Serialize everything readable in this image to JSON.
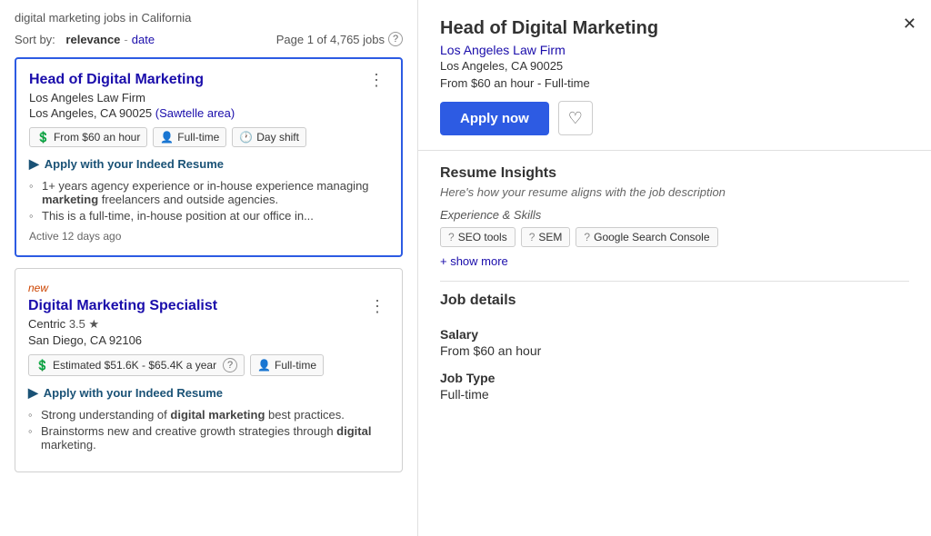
{
  "search": {
    "title": "digital marketing jobs in California",
    "sort_label": "Sort by:",
    "relevance": "relevance",
    "separator": "-",
    "date_label": "date",
    "page_info": "Page 1 of 4,765 jobs"
  },
  "jobs": [
    {
      "id": "job-1",
      "selected": true,
      "title": "Head of Digital Marketing",
      "company": "Los Angeles Law Firm",
      "location": "Los Angeles, CA 90025",
      "location_area": "(Sawtelle area)",
      "badges": [
        {
          "icon": "💲",
          "text": "From $60 an hour"
        },
        {
          "icon": "👤",
          "text": "Full-time"
        },
        {
          "icon": "🕐",
          "text": "Day shift"
        }
      ],
      "apply_indeed": "Apply with your Indeed Resume",
      "bullets": [
        "1+ years agency experience or in-house experience managing <strong>marketing</strong> freelancers and outside agencies.",
        "This is a full-time, in-house position at our office in..."
      ],
      "active": "Active 12 days ago",
      "new": false
    },
    {
      "id": "job-2",
      "selected": false,
      "title": "Digital Marketing Specialist",
      "company": "Centric",
      "rating": "3.5",
      "location": "San Diego, CA 92106",
      "badges": [
        {
          "icon": "💲",
          "text": "Estimated $51.6K - $65.4K a year",
          "has_help": true
        },
        {
          "icon": "👤",
          "text": "Full-time"
        }
      ],
      "apply_indeed": "Apply with your Indeed Resume",
      "bullets": [
        "Strong understanding of <strong>digital marketing</strong> best practices.",
        "Brainstorms new and creative growth strategies through <strong>digital</strong> marketing."
      ],
      "new": true
    }
  ],
  "detail": {
    "title": "Head of Digital Marketing",
    "company": "Los Angeles Law Firm",
    "location": "Los Angeles, CA 90025",
    "salary_line": "From $60 an hour  -  Full-time",
    "apply_btn": "Apply now",
    "resume_insights": {
      "section_title": "Resume Insights",
      "subtitle": "Here's how your resume aligns with the job description",
      "skills_label": "Experience & Skills",
      "skills": [
        {
          "label": "SEO tools"
        },
        {
          "label": "SEM"
        },
        {
          "label": "Google Search Console"
        }
      ],
      "show_more": "+ show more"
    },
    "job_details": {
      "section_title": "Job details",
      "fields": [
        {
          "label": "Salary",
          "value": "From $60 an hour"
        },
        {
          "label": "Job Type",
          "value": "Full-time"
        }
      ]
    }
  }
}
